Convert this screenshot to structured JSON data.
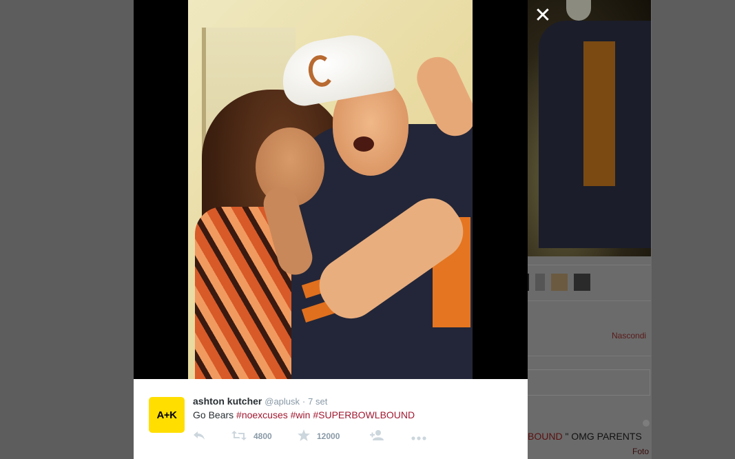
{
  "background": {
    "hide_label": "Nascondi",
    "tweet_text_prefix": "BOUND",
    "tweet_text_suffix": " \" OMG PARENTS",
    "photo_label": "Foto"
  },
  "modal": {
    "close_glyph": "✕"
  },
  "tweet": {
    "avatar_text": "A+K",
    "author_name": "ashton kutcher",
    "author_handle": "@aplusk",
    "separator": "·",
    "time": "7 set",
    "text_plain": "Go Bears ",
    "hashtags": [
      "#noexcuses",
      "#win",
      "#SUPERBOWLBOUND"
    ],
    "retweet_count": "4800",
    "favorite_count": "12000"
  },
  "icons": {
    "reply": "reply-icon",
    "retweet": "retweet-icon",
    "favorite": "star-icon",
    "follow": "follow-icon",
    "more": "more-icon",
    "close": "close-icon"
  },
  "colors": {
    "hashtag": "#a11830",
    "avatar_bg": "#ffde00",
    "overlay": "#5d5d5d"
  }
}
